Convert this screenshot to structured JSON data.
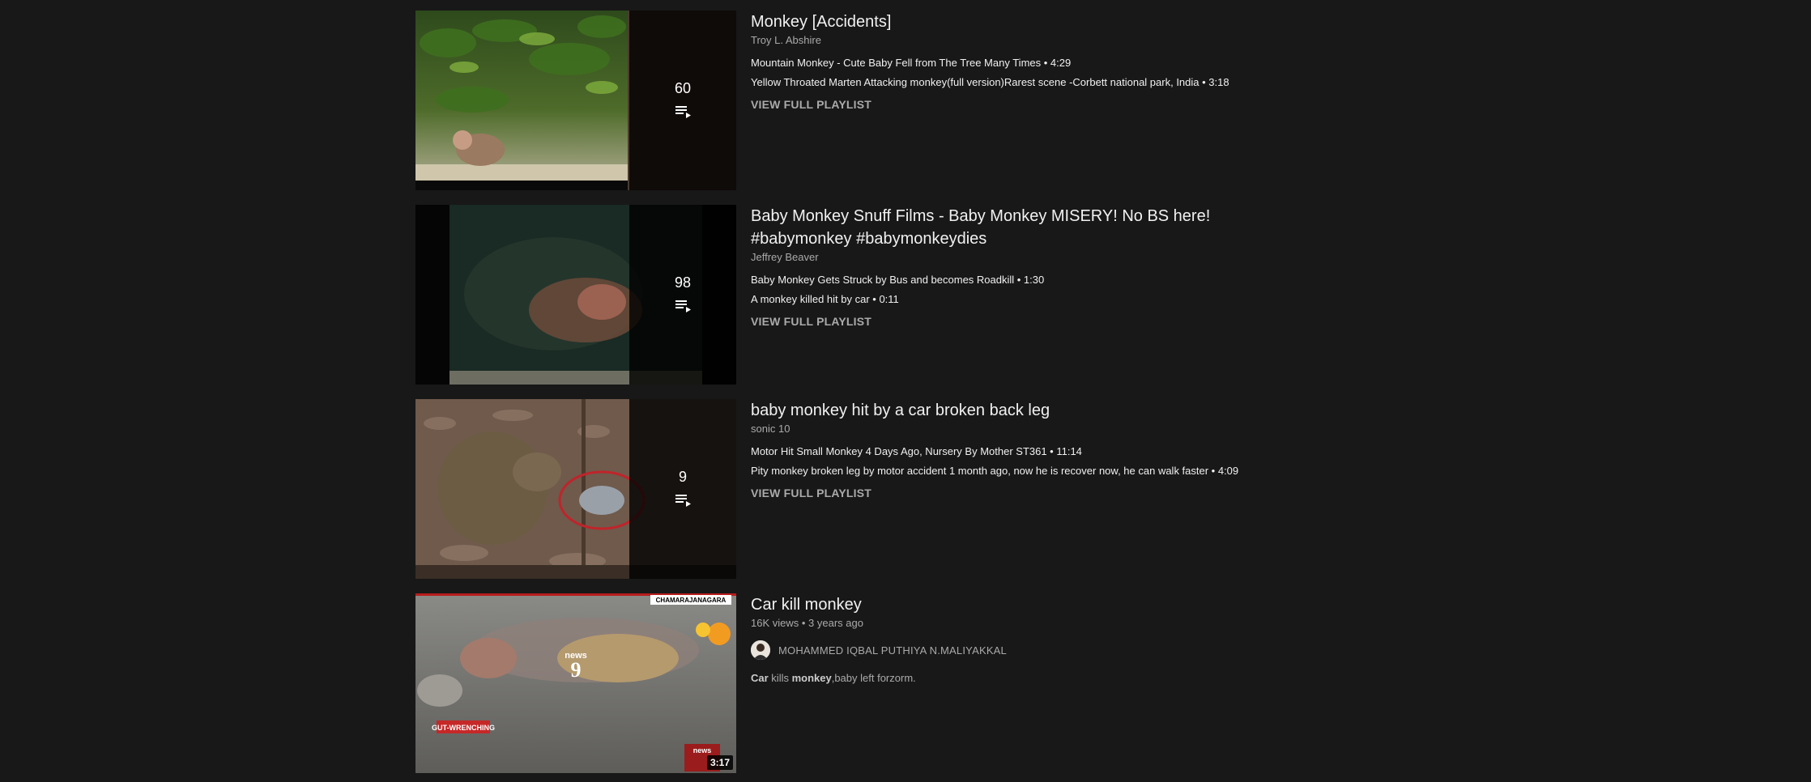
{
  "results": [
    {
      "type": "playlist",
      "title": "Monkey [Accidents]",
      "channel": "Troy L. Abshire",
      "video_count": "60",
      "videos": [
        "Mountain Monkey - Cute Baby Fell from The Tree Many Times • 4:29",
        "Yellow Throated Marten Attacking monkey(full version)Rarest scene -Corbett national park, India • 3:18"
      ],
      "view_full_label": "VIEW FULL PLAYLIST",
      "icon": "playlist-icon"
    },
    {
      "type": "playlist",
      "title_line1": "Baby Monkey Snuff Films - Baby Monkey MISERY! No BS here!",
      "title_line2": "#babymonkey #babymonkeydies",
      "channel": "Jeffrey Beaver",
      "video_count": "98",
      "videos": [
        "Baby Monkey Gets Struck by Bus and becomes Roadkill • 1:30",
        "A monkey killed hit by car • 0:11"
      ],
      "view_full_label": "VIEW FULL PLAYLIST",
      "icon": "playlist-icon"
    },
    {
      "type": "playlist",
      "title": "baby monkey hit by a car broken back leg",
      "channel": "sonic 10",
      "video_count": "9",
      "videos": [
        "Motor Hit Small Monkey 4 Days Ago, Nursery By Mother ST361 • 11:14",
        "Pity monkey broken leg by motor accident 1 month ago, now he is recover now, he can walk faster • 4:09"
      ],
      "view_full_label": "VIEW FULL PLAYLIST",
      "icon": "playlist-icon"
    },
    {
      "type": "video",
      "title": "Car kill monkey",
      "meta": "16K views • 3 years ago",
      "channel": "MOHAMMED IQBAL PUTHIYA N.MALIYAKKAL",
      "description_parts": [
        "Car",
        " kills ",
        "monkey",
        ",baby left forzorm."
      ],
      "duration": "3:17",
      "thumb_text": {
        "top_right": "CHAMARAJANAGARA",
        "news_word": "news",
        "news_number": "9",
        "banner": "GUT-WRENCHING",
        "corner_logo": "news"
      }
    }
  ],
  "colors": {
    "background": "#181818",
    "primary_text": "#f1f1f1",
    "secondary_text": "#aaaaaa"
  }
}
